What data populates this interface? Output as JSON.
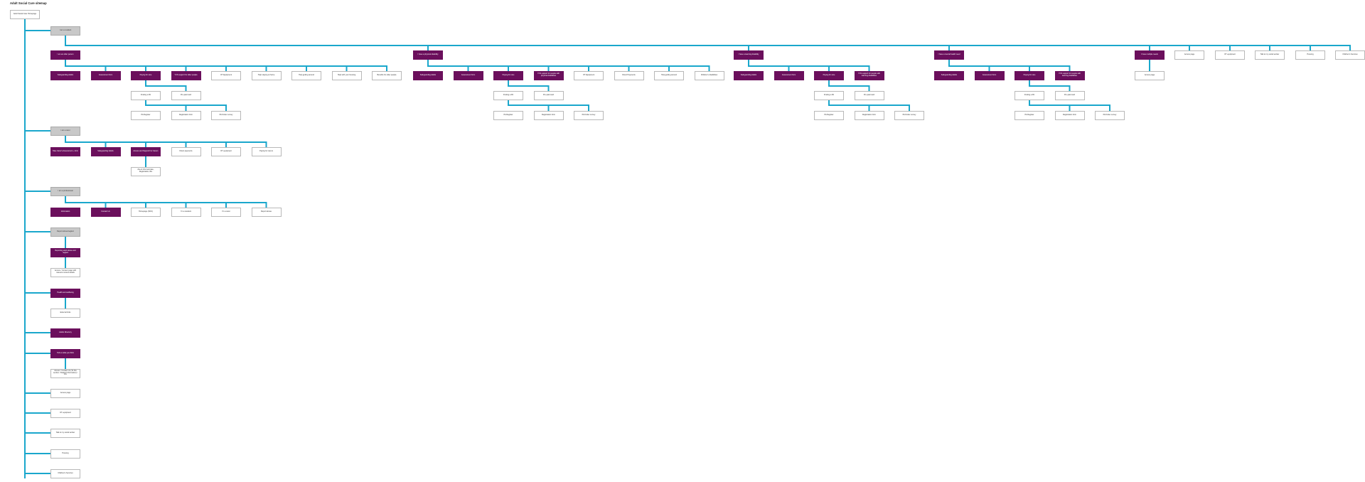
{
  "title": "Adult Social Care sitemap",
  "colors": {
    "line": "#1aa7cc",
    "purple": "#6b0f5c",
    "grey": "#c8c8c8"
  },
  "nodes": {
    "root": "Adult Social Care Homepage",
    "resident": "I am a resident",
    "older": "I am an older person",
    "older_children": [
      "Safeguarding Adults",
      "Assessment form",
      "Paying for care",
      "YCS support for older people",
      "OT Equipment",
      "Help staying at home",
      "Help getting around",
      "Help with your housing",
      "Benefits for older people"
    ],
    "physical": "I have a physical disability",
    "physical_children": [
      "Safeguarding Adults",
      "Assessment form",
      "Paying for care",
      "YCS support for people with physical disabilities",
      "OT Equipment",
      "Direct Payments",
      "Help getting around",
      "Children's disabilities"
    ],
    "learning": "I have a learning disability",
    "learning_children": [
      "Safeguarding Adults",
      "Assessment form",
      "Paying for care",
      "YCS support for people with learning disabilities"
    ],
    "mental": "I have a mental health need",
    "mental_children": [
      "Safeguarding Adults",
      "Assessment form",
      "Paying for care",
      "YCS support for people with learning disabilities"
    ],
    "multiple": "I have multiple needs",
    "multiple_child": "Access page",
    "resident_extras": [
      "Access page",
      "OT equipment",
      "Talk to my social worker",
      "Housing",
      "Children's Services"
    ],
    "pay_sub": [
      "Finding a PA",
      "Pre-paid card"
    ],
    "pa_sub": [
      "PA Register",
      "Registration form",
      "PA Finder survey"
    ],
    "pa_sub_older": [
      "PA Register",
      "Registration form",
      "PA Finder survey"
    ],
    "carer": "I am a carer",
    "carer_children": [
      "Take Carer's Assessment + form",
      "Safeguarding Adults",
      "Access and Support For Carers",
      "Direct payments",
      "OT equipment",
      "Paying for carers"
    ],
    "carer_sub": "Zoe & Jill & animate, Registration, Bio",
    "professional": "I am a professional",
    "professional_children": [
      "Information",
      "Contact Us",
      "Homepage (SOC)",
      "I'm a resident",
      "I'm a carer",
      "Report abuse"
    ],
    "report": "Report abuse/neglect",
    "report_child": "Reporting adult abuse and neglect",
    "report_grandchild": "Access / Content page with relevant content details",
    "health": "Health and wellbeing",
    "health_child": "External links",
    "adults_dir": "Adults Directory",
    "tell": "Tell us what you think",
    "tell_child": "Access / Contact Us (To this section / Related information) / link",
    "bottom": [
      "Access page",
      "OT equipment",
      "Talk to my social worker",
      "Housing",
      "Children's Services"
    ]
  }
}
